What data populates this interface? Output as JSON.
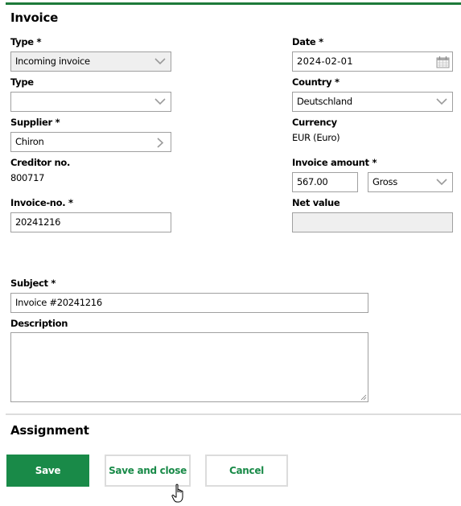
{
  "invoice": {
    "heading": "Invoice",
    "type_required": {
      "label": "Type *",
      "value": "Incoming invoice"
    },
    "type": {
      "label": "Type",
      "value": ""
    },
    "supplier": {
      "label": "Supplier *",
      "value": "Chiron"
    },
    "creditor_no": {
      "label": "Creditor no.",
      "value": "800717"
    },
    "invoice_no": {
      "label": "Invoice-no. *",
      "value": "20241216"
    },
    "date": {
      "label": "Date *",
      "value": "2024-02-01"
    },
    "country": {
      "label": "Country *",
      "value": "Deutschland"
    },
    "currency": {
      "label": "Currency",
      "value": "EUR (Euro)"
    },
    "invoice_amount": {
      "label": "Invoice amount *",
      "value": "567.00",
      "mode": "Gross"
    },
    "net_value": {
      "label": "Net value",
      "value": ""
    },
    "subject": {
      "label": "Subject *",
      "value": "Invoice #20241216"
    },
    "description": {
      "label": "Description",
      "value": ""
    }
  },
  "assignment": {
    "heading": "Assignment"
  },
  "actions": {
    "save": "Save",
    "save_and_close": "Save and close",
    "cancel": "Cancel"
  },
  "icons": {
    "dropdown": "chevron-down-icon",
    "navigate": "chevron-right-icon",
    "date": "calendar-icon"
  },
  "colors": {
    "accent": "#198a48",
    "topline": "#1e7a3a",
    "disabled_bg": "#efefef",
    "border": "#a0a0a0"
  }
}
